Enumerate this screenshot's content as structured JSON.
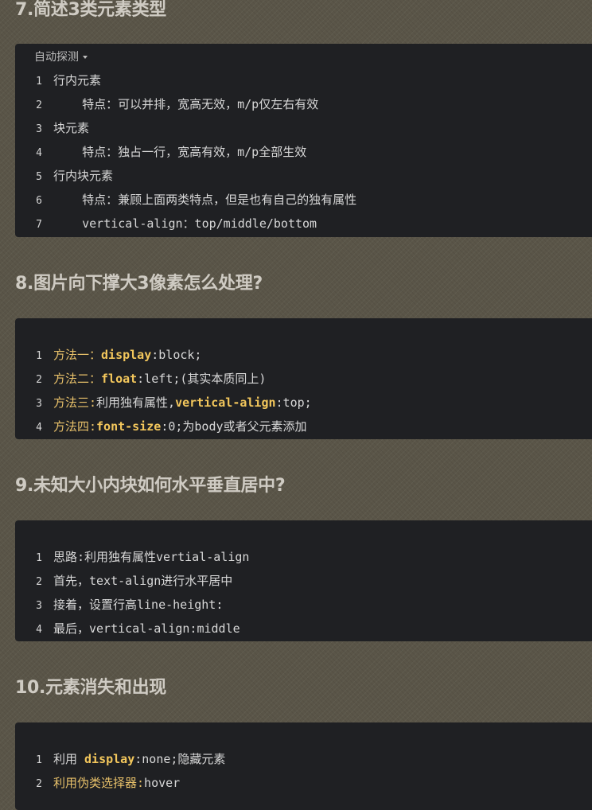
{
  "sections": [
    {
      "heading": "7.简述3类元素类型",
      "lang_label": "自动探测",
      "lines": [
        {
          "num": "1",
          "parts": [
            {
              "text": "行内元素",
              "style": "txt"
            }
          ]
        },
        {
          "num": "2",
          "parts": [
            {
              "text": "    特点：可以并排，宽高无效，m/p仅左右有效",
              "style": "txt"
            }
          ]
        },
        {
          "num": "3",
          "parts": [
            {
              "text": "块元素",
              "style": "txt"
            }
          ]
        },
        {
          "num": "4",
          "parts": [
            {
              "text": "    特点：独占一行，宽高有效，m/p全部生效",
              "style": "txt"
            }
          ]
        },
        {
          "num": "5",
          "parts": [
            {
              "text": "行内块元素",
              "style": "txt"
            }
          ]
        },
        {
          "num": "6",
          "parts": [
            {
              "text": "    特点：兼顾上面两类特点，但是也有自己的独有属性",
              "style": "txt"
            }
          ]
        },
        {
          "num": "7",
          "parts": [
            {
              "text": "    vertical-align：top/middle/bottom",
              "style": "txt"
            }
          ]
        }
      ]
    },
    {
      "heading": "8.图片向下撑大3像素怎么处理?",
      "lang_label": "",
      "lines": [
        {
          "num": "1",
          "parts": [
            {
              "text": "方法一：",
              "style": "yel"
            },
            {
              "text": "display",
              "style": "key"
            },
            {
              "text": ":block;",
              "style": "txt"
            }
          ]
        },
        {
          "num": "2",
          "parts": [
            {
              "text": "方法二：",
              "style": "yel"
            },
            {
              "text": "float",
              "style": "key"
            },
            {
              "text": ":left;(其实本质同上)",
              "style": "txt"
            }
          ]
        },
        {
          "num": "3",
          "parts": [
            {
              "text": "方法三:",
              "style": "yel"
            },
            {
              "text": "利用独有属性,",
              "style": "txt"
            },
            {
              "text": "vertical-align",
              "style": "key"
            },
            {
              "text": ":top;",
              "style": "txt"
            }
          ]
        },
        {
          "num": "4",
          "parts": [
            {
              "text": "方法四:",
              "style": "yel"
            },
            {
              "text": "font-size",
              "style": "key"
            },
            {
              "text": ":0;为body或者父元素添加",
              "style": "txt"
            }
          ]
        }
      ]
    },
    {
      "heading": "9.未知大小内块如何水平垂直居中?",
      "lang_label": "",
      "lines": [
        {
          "num": "1",
          "parts": [
            {
              "text": "思路:利用独有属性vertial-align",
              "style": "txt"
            }
          ]
        },
        {
          "num": "2",
          "parts": [
            {
              "text": "首先，text-align进行水平居中",
              "style": "txt"
            }
          ]
        },
        {
          "num": "3",
          "parts": [
            {
              "text": "接着，设置行高line-height:",
              "style": "txt"
            }
          ]
        },
        {
          "num": "4",
          "parts": [
            {
              "text": "最后，vertical-align:middle",
              "style": "txt"
            }
          ]
        }
      ]
    },
    {
      "heading": "10.元素消失和出现",
      "lang_label": "",
      "lines": [
        {
          "num": "1",
          "parts": [
            {
              "text": "利用 ",
              "style": "txt"
            },
            {
              "text": "display",
              "style": "key"
            },
            {
              "text": ":none;隐藏元素",
              "style": "txt"
            }
          ]
        },
        {
          "num": "2",
          "parts": [
            {
              "text": "利用伪类选择器:",
              "style": "yel"
            },
            {
              "text": "hover",
              "style": "txt"
            }
          ]
        }
      ]
    }
  ]
}
